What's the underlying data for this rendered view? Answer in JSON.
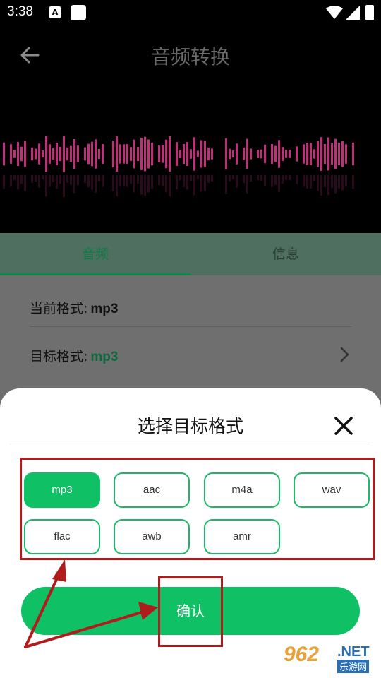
{
  "status_bar": {
    "time": "3:38",
    "notification_icon": "A"
  },
  "header": {
    "title": "音频转换",
    "back_icon": "arrow-left-icon"
  },
  "tabs": [
    {
      "label": "音频",
      "active": true
    },
    {
      "label": "信息",
      "active": false
    }
  ],
  "settings": {
    "current_format_label": "当前格式:",
    "current_format_value": "mp3",
    "target_format_label": "目标格式:",
    "target_format_value": "mp3"
  },
  "sheet": {
    "title": "选择目标格式",
    "formats": [
      "mp3",
      "aac",
      "m4a",
      "wav",
      "flac",
      "awb",
      "amr"
    ],
    "selected": "mp3",
    "confirm_label": "确认"
  },
  "watermark": {
    "logo": "962",
    "net": ".NET",
    "sub": "乐游网"
  },
  "colors": {
    "accent": "#0fc064",
    "annotation": "#b01c1c",
    "waveform": "#c0307a"
  }
}
